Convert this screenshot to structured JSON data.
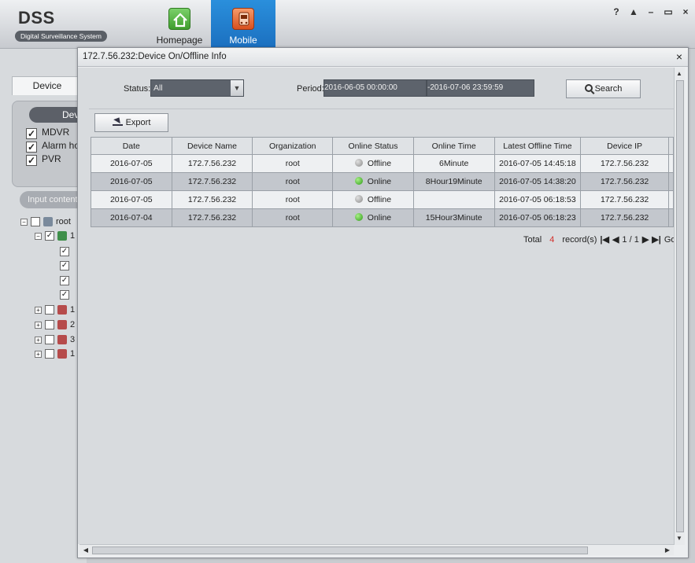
{
  "app": {
    "logo_title": "DSS",
    "logo_subtitle": "Digital Surveillance System",
    "nav": [
      {
        "label": "Homepage",
        "icon": "home-icon"
      },
      {
        "label": "Mobile",
        "icon": "bus-icon"
      }
    ],
    "window_controls": [
      "?",
      "▲",
      "–",
      "▭",
      "×"
    ]
  },
  "left_panel": {
    "tab_label": "Device",
    "device_pill": "Dev",
    "checks": [
      {
        "label": "MDVR",
        "checked": true
      },
      {
        "label": "Alarm hos",
        "checked": true
      },
      {
        "label": "PVR",
        "checked": true
      }
    ],
    "input_placeholder": "Input contents",
    "tree_root": "root",
    "tree_items": [
      "1",
      "",
      "",
      "",
      "",
      "1",
      "2",
      "3",
      "1"
    ]
  },
  "dialog": {
    "title": "172.7.56.232:Device On/Offline Info",
    "close": "×",
    "status_label": "Status:",
    "status_value": "All",
    "period_label": "Period:",
    "period_start": "2016-06-05 00:00:00",
    "period_sep": "-",
    "period_end": "2016-07-06 23:59:59",
    "search_label": "Search",
    "export_label": "Export",
    "table": {
      "headers": [
        "Date",
        "Device Name",
        "Organization",
        "Online Status",
        "Online Time",
        "Latest Offline Time",
        "Device IP"
      ],
      "rows": [
        [
          "2016-07-05",
          "172.7.56.232",
          "root",
          "Offline",
          "6Minute",
          "2016-07-05 14:45:18",
          "172.7.56.232"
        ],
        [
          "2016-07-05",
          "172.7.56.232",
          "root",
          "Online",
          "8Hour19Minute",
          "2016-07-05 14:38:20",
          "172.7.56.232"
        ],
        [
          "2016-07-05",
          "172.7.56.232",
          "root",
          "Offline",
          "",
          "2016-07-05 06:18:53",
          "172.7.56.232"
        ],
        [
          "2016-07-04",
          "172.7.56.232",
          "root",
          "Online",
          "15Hour3Minute",
          "2016-07-05 06:18:23",
          "172.7.56.232"
        ]
      ]
    },
    "pager": {
      "total_label": "Total",
      "total_count": "4",
      "records_label": "record(s)",
      "page_text": "1 / 1",
      "goto_label": "Go to"
    }
  },
  "colors": {
    "accent_blue": "#1b6fbf",
    "online_green": "#2e9a17",
    "offline_gray": "#8a8a8a",
    "count_red": "#d3302b"
  }
}
